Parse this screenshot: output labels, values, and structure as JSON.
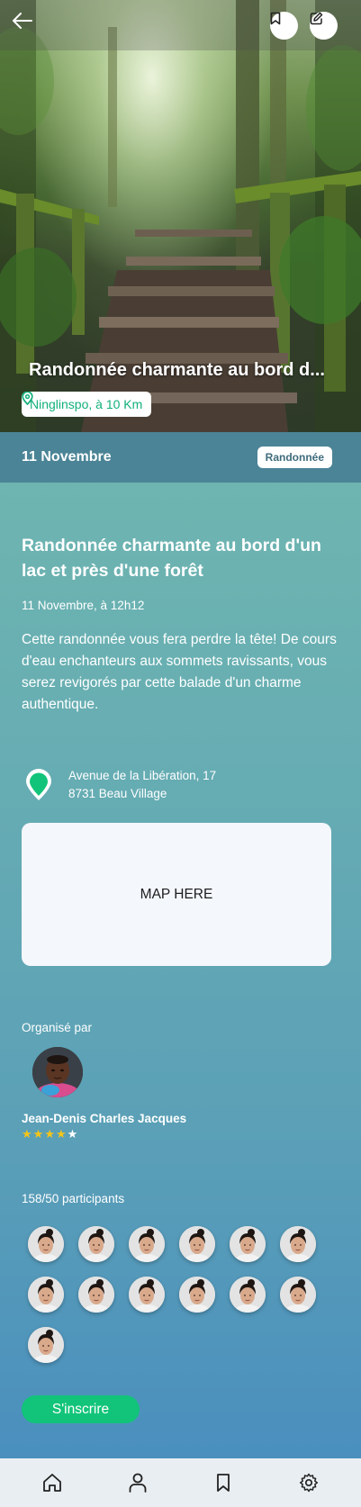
{
  "hero": {
    "title": "Randonnée charmante au bord d...",
    "location_chip": "Ninglinspo, à 10 Km"
  },
  "header_actions": {
    "back_icon": "arrow-left-icon",
    "bookmark_icon": "bookmark-icon",
    "edit_icon": "edit-icon"
  },
  "date_bar": {
    "date": "11 Novembre",
    "category": "Randonnée"
  },
  "event": {
    "title": "Randonnée charmante au bord d'un lac et près d'une forêt",
    "datetime": "11 Novembre, à 12h12",
    "description": "Cette randonnée vous fera perdre la tête! De cours d'eau enchanteurs aux sommets ravissants, vous serez revigorés par cette balade d'un charme authentique."
  },
  "address": {
    "line1": "Avenue de la Libération, 17",
    "line2": "8731 Beau Village"
  },
  "map": {
    "placeholder": "MAP HERE"
  },
  "organizer": {
    "label": "Organisé par",
    "name": "Jean-Denis Charles Jacques",
    "rating": 4,
    "rating_max": 5
  },
  "participants": {
    "label": "158/50 participants",
    "shown_avatars": 13
  },
  "actions": {
    "signup_label": "S'inscrire"
  },
  "bottom_nav": [
    {
      "icon": "home-icon"
    },
    {
      "icon": "user-icon"
    },
    {
      "icon": "bookmark-icon"
    },
    {
      "icon": "settings-icon"
    }
  ],
  "colors": {
    "accent_green": "#12c479",
    "date_bar": "#4b8496",
    "gradient_top": "#6fb6b0",
    "gradient_bottom": "#4a8fbe",
    "nav_bg": "#e9eef2"
  }
}
